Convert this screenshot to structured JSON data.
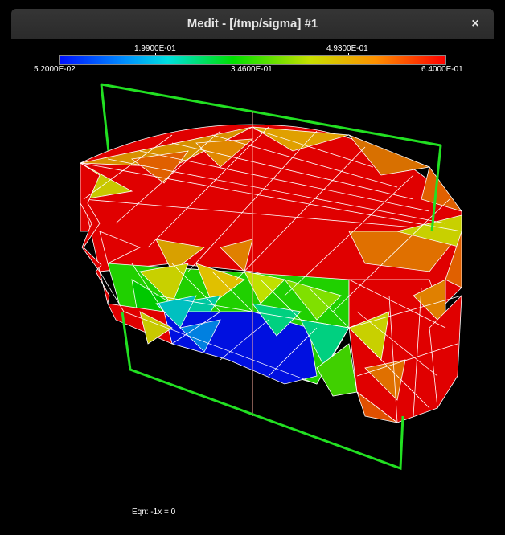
{
  "window": {
    "title": "Medit - [/tmp/sigma] #1",
    "close_glyph": "×"
  },
  "colorbar": {
    "min_label": "5.2000E-02",
    "mid_label": "3.4600E-01",
    "max_label": "6.4000E-01",
    "upper_left_label": "1.9900E-01",
    "upper_right_label": "4.9300E-01"
  },
  "status": {
    "equation": "Eqn:  -1x = 0"
  },
  "colors": {
    "clip_plane": "#22e022",
    "mesh_edges": "#ffffff",
    "axis_line": "#ffb0a0"
  }
}
